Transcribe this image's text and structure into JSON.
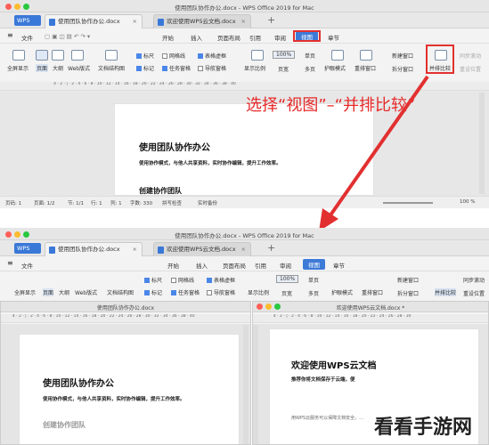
{
  "app_title": "使用团队协作办公.docx - WPS Office 2019 for Mac",
  "tabs": {
    "wps": "WPS",
    "doc1": "使用团队协作办公.docx",
    "doc2": "欢迎使用WPS云文档.docx"
  },
  "menu": {
    "file": "文件",
    "items": [
      "开始",
      "插入",
      "页面布局",
      "引用",
      "审阅",
      "视图",
      "章节"
    ]
  },
  "toolbar": {
    "fullscreen": "全屏显示",
    "page": "页面",
    "outline": "大纲",
    "web": "Web版式",
    "doc_structure": "文档结构图",
    "ruler": "标尺",
    "gridlines": "网格线",
    "table_borders": "表格虚框",
    "marks": "标记",
    "task_pane": "任务窗格",
    "nav_pane": "导航窗格",
    "display_ratio": "显示比例",
    "zoom_value": "100%",
    "single_page": "单页",
    "page_width": "页宽",
    "multi_page": "多页",
    "eye_mode": "护眼模式",
    "rearrange": "重排窗口",
    "new_window": "新建窗口",
    "split_window": "拆分窗口",
    "side_by_side": "并排比较",
    "sync_scroll": "同步滚动",
    "reset_pos": "重设位置"
  },
  "callout": "选择“视图”–“并排比较”",
  "document": {
    "title": "使用团队协作办公",
    "subtitle": "使用协作模式，与他人共享资料，实时协作编辑，提升工作效率。",
    "section": "创建协作团队"
  },
  "status": {
    "page_num": "页码: 1",
    "pages": "页面: 1/2",
    "section": "节: 1/1",
    "row": "行: 1",
    "col": "列: 1",
    "words": "字数: 330",
    "spellcheck": "拼写检查",
    "backup": "实时备份",
    "zoom": "100 %"
  },
  "subwindows": {
    "left_title": "使用团队协作办公.docx",
    "right_title": "欢迎使用WPS云文档.docx *"
  },
  "doc2": {
    "title": "欢迎使用WPS云文档",
    "subtitle": "推荐你将文档保存于云端，便",
    "body": "用WPS云服务可以保障文档安全，…"
  },
  "watermark": "看看手游网",
  "colors": {
    "accent": "#3d7ad8",
    "highlight": "#e23030"
  }
}
